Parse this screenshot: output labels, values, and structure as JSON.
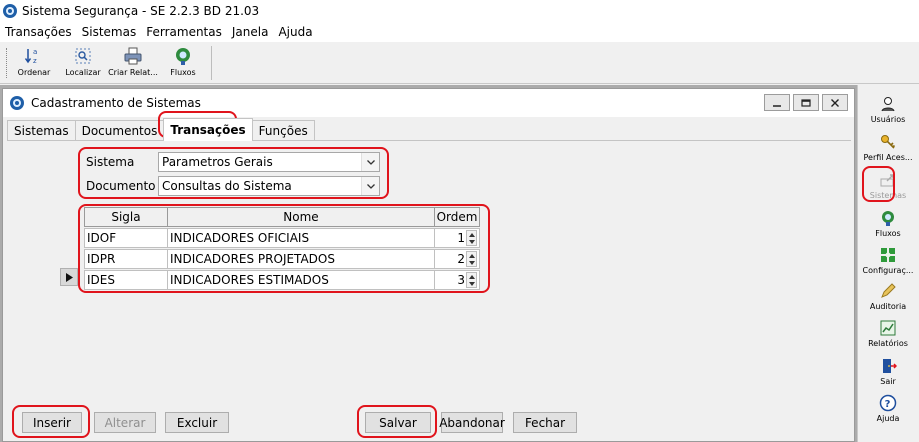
{
  "app": {
    "title": "Sistema Segurança  -  SE 2.2.3 BD 21.03"
  },
  "menu": [
    "Transações",
    "Sistemas",
    "Ferramentas",
    "Janela",
    "Ajuda"
  ],
  "toolbar": {
    "ordenar": "Ordenar",
    "localizar": "Localizar",
    "criar_relat": "Criar Relat...",
    "fluxos": "Fluxos"
  },
  "window": {
    "title": "Cadastramento de Sistemas"
  },
  "tabs": [
    "Sistemas",
    "Documentos",
    "Transações",
    "Funções"
  ],
  "form": {
    "sistema_label": "Sistema",
    "sistema_value": "Parametros Gerais",
    "documento_label": "Documento",
    "documento_value": "Consultas do Sistema"
  },
  "grid": {
    "headers": {
      "sigla": "Sigla",
      "nome": "Nome",
      "ordem": "Ordem"
    },
    "rows": [
      {
        "sigla": "IDOF",
        "nome": "INDICADORES OFICIAIS",
        "ordem": "1"
      },
      {
        "sigla": "IDPR",
        "nome": "INDICADORES PROJETADOS",
        "ordem": "2"
      },
      {
        "sigla": "IDES",
        "nome": "INDICADORES ESTIMADOS",
        "ordem": "3"
      }
    ]
  },
  "buttons": {
    "inserir": "Inserir",
    "alterar": "Alterar",
    "excluir": "Excluir",
    "salvar": "Salvar",
    "abandonar": "Abandonar",
    "fechar": "Fechar"
  },
  "side": {
    "usuarios": "Usuários",
    "perfil": "Perfil Aces...",
    "sistemas": "Sistemas",
    "fluxos": "Fluxos",
    "configuracao": "Configuraç...",
    "auditoria": "Auditoria",
    "relatorios": "Relatórios",
    "sair": "Sair",
    "ajuda": "Ajuda"
  },
  "colors": {
    "highlight": "#e0141c"
  }
}
